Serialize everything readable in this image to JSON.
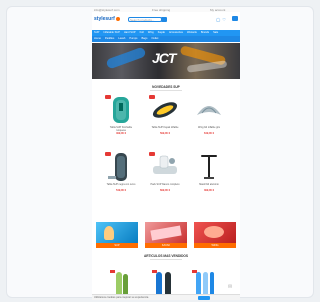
{
  "topstrip": {
    "left": "info@stylesurf.com",
    "mid": "Free shipping",
    "right": "My account"
  },
  "header": {
    "logo": "stylesurf",
    "search_placeholder": "Search products..."
  },
  "nav1": [
    "SUP",
    "Inflatable SUP",
    "Hard SUP",
    "Foil",
    "Wing",
    "Kayak",
    "Accessories",
    "Wetsuits",
    "Brands",
    "Sale"
  ],
  "nav2": [
    "Home",
    "Paddles",
    "Leash",
    "Pumps",
    "Bags",
    "Outlet"
  ],
  "hero": {
    "brand": "JCT"
  },
  "sections": {
    "featured": "NOVEDADES SUP",
    "best": "ARTICULOS MAS VENDIDOS"
  },
  "products": [
    {
      "name": "Tabla SUP hinchable turquesa",
      "price": "499,00 €"
    },
    {
      "name": "Tabla SUP Kayak inflable",
      "price": "599,00 €"
    },
    {
      "name": "Wing foil inflable gris",
      "price": "649,00 €"
    },
    {
      "name": "Tabla SUP negra con remo",
      "price": "549,00 €"
    },
    {
      "name": "Pack SUP blanco completo",
      "price": "699,00 €"
    },
    {
      "name": "Mastil foil aluminio",
      "price": "399,00 €"
    }
  ],
  "banners": [
    {
      "caption": "SUP"
    },
    {
      "caption": "KAYAK"
    },
    {
      "caption": "WING"
    }
  ],
  "cookie": {
    "text": "Utilizamos cookies para mejorar su experiencia"
  },
  "colors": {
    "primary": "#2196f3",
    "accent": "#e53935",
    "orange": "#ff6d00"
  }
}
